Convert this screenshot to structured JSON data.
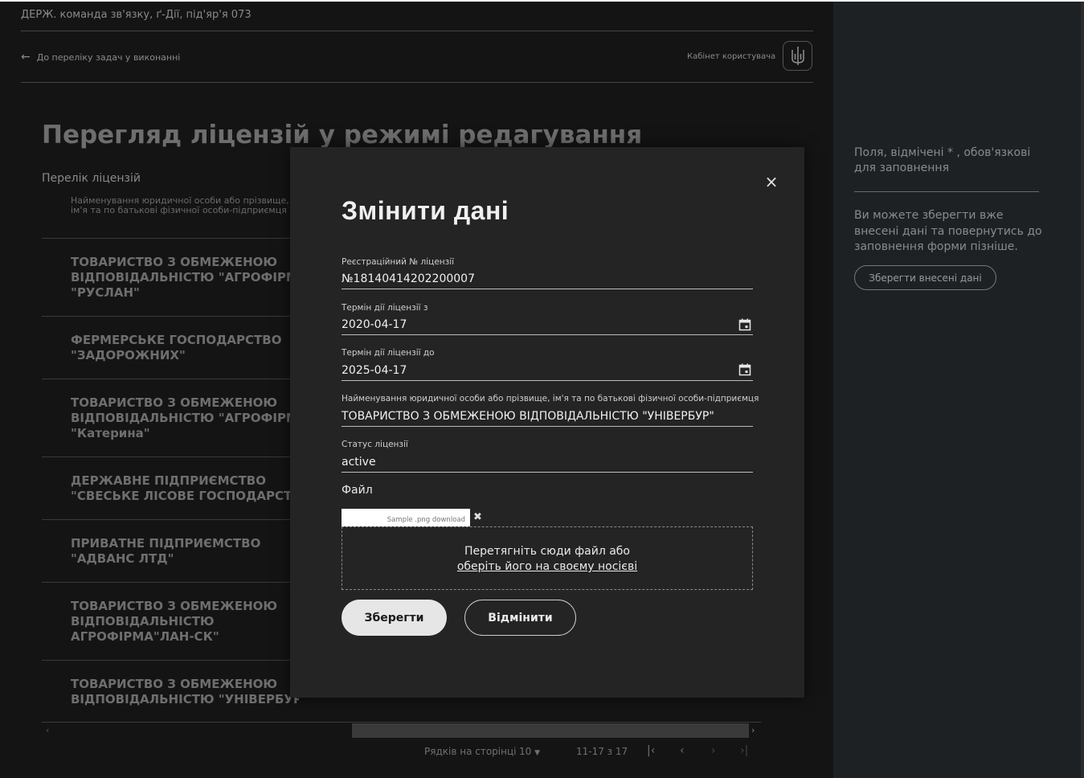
{
  "header": {
    "org_name": "ДЕРЖ. команда зв'язку, ґ-Дії, під'яр'я 073",
    "back_link": "До переліку задач у виконанні",
    "cabinet": "Кабінет користувача"
  },
  "main": {
    "page_title": "Перегляд ліцензій у режимі редагування",
    "list_title": "Перелік ліцензій",
    "column_header": "Найменування юридичної особи або прізвище, ім'я та по батькові фізичної особи-підприємця",
    "rows": [
      "ТОВАРИСТВО З ОБМЕЖЕНОЮ ВІДПОВІДАЛЬНІСТЮ \"АГРОФІРМА \"РУСЛАН\"",
      "ФЕРМЕРСЬКЕ ГОСПОДАРСТВО \"ЗАДОРОЖНИХ\"",
      "ТОВАРИСТВО З ОБМЕЖЕНОЮ ВІДПОВІДАЛЬНІСТЮ \"АГРОФІРМА \"Катерина\"",
      "ДЕРЖАВНЕ ПІДПРИЄМСТВО \"СВЕСЬКЕ ЛІСОВЕ ГОСПОДАРСТВО\"",
      "ПРИВАТНЕ ПІДПРИЄМСТВО \"АДВАНС ЛТД\"",
      "ТОВАРИСТВО З ОБМЕЖЕНОЮ ВІДПОВІДАЛЬНІСТЮ АГРОФІРМА\"ЛАН-СК\"",
      "ТОВАРИСТВО З ОБМЕЖЕНОЮ ВІДПОВІДАЛЬНІСТЮ \"УНІВЕРБУР\""
    ],
    "row_lines": [
      [
        "ТОВАРИСТВО З ОБМЕЖЕНОЮ",
        "ВІДПОВІДАЛЬНІСТЮ \"АГРОФІРМА",
        "\"РУСЛАН\""
      ],
      [
        "ФЕРМЕРСЬКЕ ГОСПОДАРСТВО",
        "\"ЗАДОРОЖНИХ\""
      ],
      [
        "ТОВАРИСТВО З ОБМЕЖЕНОЮ",
        "ВІДПОВІДАЛЬНІСТЮ \"АГРОФІРМА",
        "\"Катерина\""
      ],
      [
        "ДЕРЖАВНЕ ПІДПРИЄМСТВО",
        "\"СВЕСЬКЕ ЛІСОВЕ ГОСПОДАРСТВО"
      ],
      [
        "ПРИВАТНЕ ПІДПРИЄМСТВО",
        "\"АДВАНС ЛТД\""
      ],
      [
        "ТОВАРИСТВО З ОБМЕЖЕНОЮ",
        "ВІДПОВІДАЛЬНІСТЮ",
        "АГРОФІРМА\"ЛАН-СК\""
      ],
      [
        "ТОВАРИСТВО З ОБМЕЖЕНОЮ",
        "ВІДПОВІДАЛЬНІСТЮ \"УНІВЕРБУР\""
      ]
    ],
    "pagination": {
      "rows_per_page_label": "Рядків на сторінці",
      "rows_per_page_value": "10",
      "range": "11-17 з 17"
    }
  },
  "right_panel": {
    "required_note": "Поля, відмічені * , обов'язкові для заповнення",
    "save_note": "Ви можете зберегти вже внесені дані та повернутись до заповнення форми пізніше.",
    "save_draft_button": "Зберегти внесені дані"
  },
  "modal": {
    "title": "Змінити дані",
    "fields": {
      "reg_number": {
        "label": "Реєстраційний № ліцензії",
        "value": "№18140414202200007"
      },
      "valid_from": {
        "label": "Термін дії ліцензії з",
        "value": "2020-04-17"
      },
      "valid_to": {
        "label": "Термін дії ліцензії до",
        "value": "2025-04-17"
      },
      "org_name": {
        "label": "Найменування юридичної особи або прізвище, ім'я та по батькові фізичної особи-підприємця",
        "value": "ТОВАРИСТВО З ОБМЕЖЕНОЮ ВІДПОВІДАЛЬНІСТЮ \"УНІВЕРБУР\""
      },
      "status": {
        "label": "Статус ліцензії",
        "value": "active"
      }
    },
    "file": {
      "label": "Файл",
      "chip": "Sample .png download",
      "dropzone_text": "Перетягніть сюди файл або",
      "dropzone_link": "оберіть його на своєму носієві"
    },
    "save_button": "Зберегти",
    "cancel_button": "Відмінити"
  }
}
